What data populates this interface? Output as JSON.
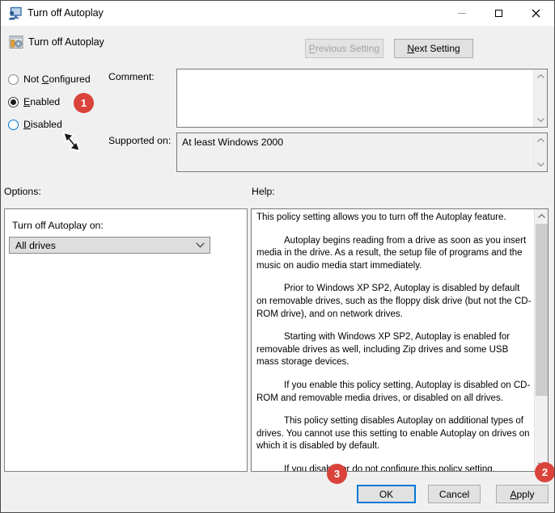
{
  "window": {
    "title": "Turn off Autoplay"
  },
  "header": {
    "title": "Turn off Autoplay",
    "previous_button": {
      "accel": "P",
      "rest": "revious Setting"
    },
    "next_button": {
      "accel": "N",
      "rest": "ext Setting"
    }
  },
  "settings": {
    "radios": {
      "not_configured": {
        "pre": "Not ",
        "accel": "C",
        "rest": "onfigured",
        "selected": false
      },
      "enabled": {
        "pre": "",
        "accel": "E",
        "rest": "nabled",
        "selected": true
      },
      "disabled": {
        "pre": "",
        "accel": "D",
        "rest": "isabled",
        "selected": false
      }
    },
    "comment_label": "Comment:",
    "comment_value": "",
    "supported_label": "Supported on:",
    "supported_value": "At least Windows 2000"
  },
  "options": {
    "label": "Options:",
    "dropdown_label": "Turn off Autoplay on:",
    "dropdown_value": "All drives"
  },
  "help": {
    "label": "Help:",
    "paragraphs": [
      "This policy setting allows you to turn off the Autoplay feature.",
      "Autoplay begins reading from a drive as soon as you insert media in the drive. As a result, the setup file of programs and the music on audio media start immediately.",
      "Prior to Windows XP SP2, Autoplay is disabled by default on removable drives, such as the floppy disk drive (but not the CD-ROM drive), and on network drives.",
      "Starting with Windows XP SP2, Autoplay is enabled for removable drives as well, including Zip drives and some USB mass storage devices.",
      "If you enable this policy setting, Autoplay is disabled on CD-ROM and removable media drives, or disabled on all drives.",
      "This policy setting disables Autoplay on additional types of drives. You cannot use this setting to enable Autoplay on drives on which it is disabled by default.",
      "If you disable or do not configure this policy setting, AutoPlay is enabled."
    ]
  },
  "footer": {
    "ok": "OK",
    "cancel": "Cancel",
    "apply": {
      "accel": "A",
      "rest": "pply"
    }
  },
  "annotations": {
    "step1": "1",
    "step2": "2",
    "step3": "3"
  },
  "colors": {
    "accent_blue": "#0078d7",
    "badge_red": "#d9433b",
    "disabled_text": "#a1a1a1"
  }
}
